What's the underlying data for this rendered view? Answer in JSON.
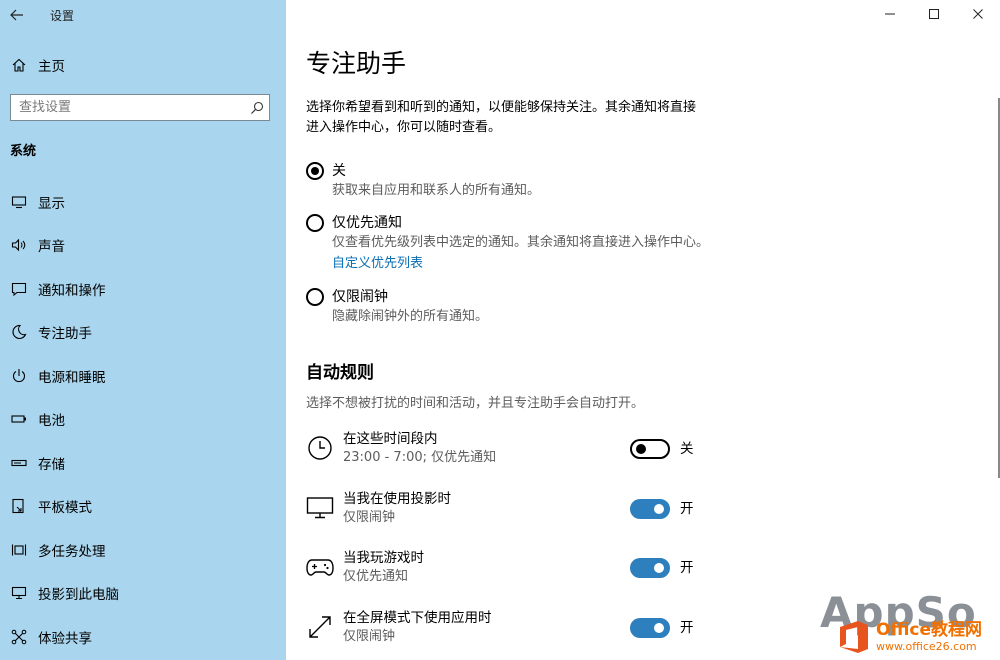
{
  "window": {
    "title": "设置",
    "back_icon": "back-arrow-icon",
    "minimize_icon": "minimize-icon",
    "maximize_icon": "maximize-icon",
    "close_icon": "close-icon"
  },
  "sidebar": {
    "home_label": "主页",
    "search_placeholder": "查找设置",
    "section_title": "系统",
    "items": [
      {
        "label": "显示",
        "icon": "monitor-icon"
      },
      {
        "label": "声音",
        "icon": "speaker-icon"
      },
      {
        "label": "通知和操作",
        "icon": "notification-icon"
      },
      {
        "label": "专注助手",
        "icon": "moon-icon"
      },
      {
        "label": "电源和睡眠",
        "icon": "power-icon"
      },
      {
        "label": "电池",
        "icon": "battery-icon"
      },
      {
        "label": "存储",
        "icon": "storage-icon"
      },
      {
        "label": "平板模式",
        "icon": "tablet-icon"
      },
      {
        "label": "多任务处理",
        "icon": "multitask-icon"
      },
      {
        "label": "投影到此电脑",
        "icon": "project-icon"
      },
      {
        "label": "体验共享",
        "icon": "share-icon"
      }
    ]
  },
  "main": {
    "title": "专注助手",
    "intro": "选择你希望看到和听到的通知，以便能够保持关注。其余通知将直接进入操作中心，你可以随时查看。",
    "options": [
      {
        "label": "关",
        "desc": "获取来自应用和联系人的所有通知。",
        "selected": true
      },
      {
        "label": "仅优先通知",
        "desc": "仅查看优先级列表中选定的通知。其余通知将直接进入操作中心。",
        "link": "自定义优先列表",
        "selected": false
      },
      {
        "label": "仅限闹钟",
        "desc": "隐藏除闹钟外的所有通知。",
        "selected": false
      }
    ],
    "auto_rules": {
      "title": "自动规则",
      "desc": "选择不想被打扰的时间和活动，并且专注助手会自动打开。",
      "rules": [
        {
          "title": "在这些时间段内",
          "sub": "23:00 - 7:00; 仅优先通知",
          "state": "关",
          "on": false,
          "icon": "clock-icon"
        },
        {
          "title": "当我在使用投影时",
          "sub": "仅限闹钟",
          "state": "开",
          "on": true,
          "icon": "monitor-icon"
        },
        {
          "title": "当我玩游戏时",
          "sub": "仅优先通知",
          "state": "开",
          "on": true,
          "icon": "gamepad-icon"
        },
        {
          "title": "在全屏模式下使用应用时",
          "sub": "仅限闹钟",
          "state": "开",
          "on": true,
          "icon": "fullscreen-arrow-icon"
        }
      ]
    }
  },
  "watermark": {
    "appso": "AppSo",
    "office_name": "Office教程网",
    "office_url": "www.office26.com"
  },
  "colors": {
    "sidebar_bg": "#a9d6ee",
    "accent": "#2d7fbd",
    "link": "#0a6fb5"
  }
}
